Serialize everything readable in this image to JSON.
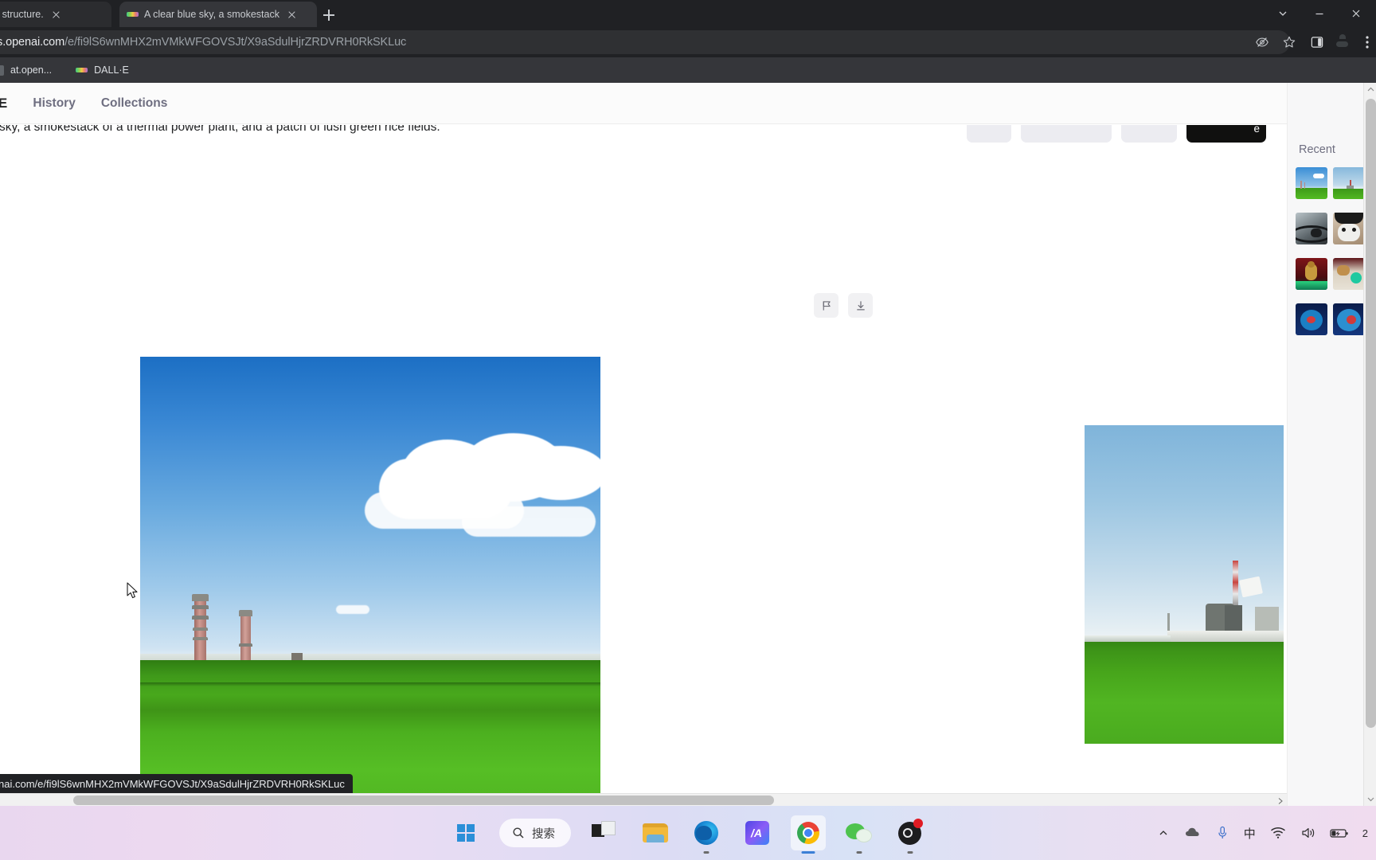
{
  "browser": {
    "tabs": [
      {
        "title": "ng sentence structure.",
        "favicon": "generic-page-icon",
        "active": false
      },
      {
        "title": "A clear blue sky, a smokestack",
        "favicon": "dalle-icon",
        "active": true
      }
    ],
    "new_tab_label": "+",
    "address": {
      "host": "labs.openai.com",
      "path": "/e/fi9lS6wnMHX2mVMkWFGOVSJt/X9aSdulHjrZRDVRH0RkSKLuc",
      "lock": "secure-lock-icon"
    },
    "omnibox_icons": [
      "incognito-eye-off-icon",
      "bookmark-star-icon"
    ],
    "toolbar_icons": [
      "side-panel-icon",
      "profile-avatar-icon",
      "chrome-menu-icon"
    ],
    "window_controls": [
      "minimize",
      "maximize",
      "close"
    ],
    "bookmarks": [
      {
        "label": "at.open...",
        "favicon": "generic-page-icon"
      },
      {
        "label": "DALL·E",
        "favicon": "dalle-icon"
      }
    ],
    "status_bar_url": "nai.com/e/fi9lS6wnMHX2mVMkWFGOVSJt/X9aSdulHjrZRDVRH0RkSKLuc"
  },
  "site": {
    "brand": "·E",
    "nav": [
      {
        "label": "History"
      },
      {
        "label": "Collections"
      }
    ],
    "prompt": "lue sky, a smokestack of a thermal power plant, and a patch of lush green rice fields.",
    "actions": [
      {
        "label": "",
        "style": "light"
      },
      {
        "label": "",
        "style": "light"
      },
      {
        "label": "",
        "style": "light"
      },
      {
        "label": "e",
        "style": "dark"
      }
    ],
    "image_tools": [
      {
        "name": "flag-icon",
        "label": "Report"
      },
      {
        "name": "download-icon",
        "label": "Download"
      }
    ],
    "generated_images": [
      {
        "alt": "A clear blue sky with cumulus clouds, two tall smokestacks of a thermal power plant on the horizon, and a patch of lush green rice fields",
        "primary": true
      },
      {
        "alt": "Hazy blue sky over a thermal power plant with a red-and-white striped smokestack beside green rice fields",
        "primary": false
      }
    ],
    "recent": {
      "title": "Recent",
      "rows": [
        {
          "items": [
            "power-plant-blue-sky",
            "power-plant-hazy-sky"
          ]
        },
        {
          "items": [
            "skateboard-photo",
            "cat-in-hat-photo"
          ]
        },
        {
          "items": [
            "bear-on-stage",
            "dog-with-orb"
          ]
        },
        {
          "items": [
            "fish-bowl-blue",
            "fish-bowl-red"
          ]
        }
      ]
    }
  },
  "taskbar": {
    "start_label": "Windows Start",
    "search_placeholder": "搜索",
    "search_icon": "magnifier-icon",
    "apps": [
      {
        "name": "task-view-icon",
        "running": false
      },
      {
        "name": "file-explorer-icon",
        "running": false
      },
      {
        "name": "microsoft-edge-icon",
        "running": true
      },
      {
        "name": "ai-app-icon",
        "running": false
      },
      {
        "name": "google-chrome-icon",
        "running": true,
        "active": true
      },
      {
        "name": "wechat-icon",
        "running": true
      },
      {
        "name": "obs-studio-icon",
        "running": true,
        "badge": true
      }
    ],
    "tray": {
      "icons": [
        "chevron-up-icon",
        "cloud-icon",
        "microphone-icon",
        "ime-chinese-icon",
        "wifi-icon",
        "volume-icon",
        "battery-charging-icon"
      ],
      "ime_label": "中",
      "edge_text": "2"
    }
  },
  "colors": {
    "chrome_bg": "#202124",
    "tab_active": "#35363a",
    "accent_dark": "#10100f",
    "panel_bg": "#f7f7f8",
    "text_muted": "#6e6e80"
  }
}
